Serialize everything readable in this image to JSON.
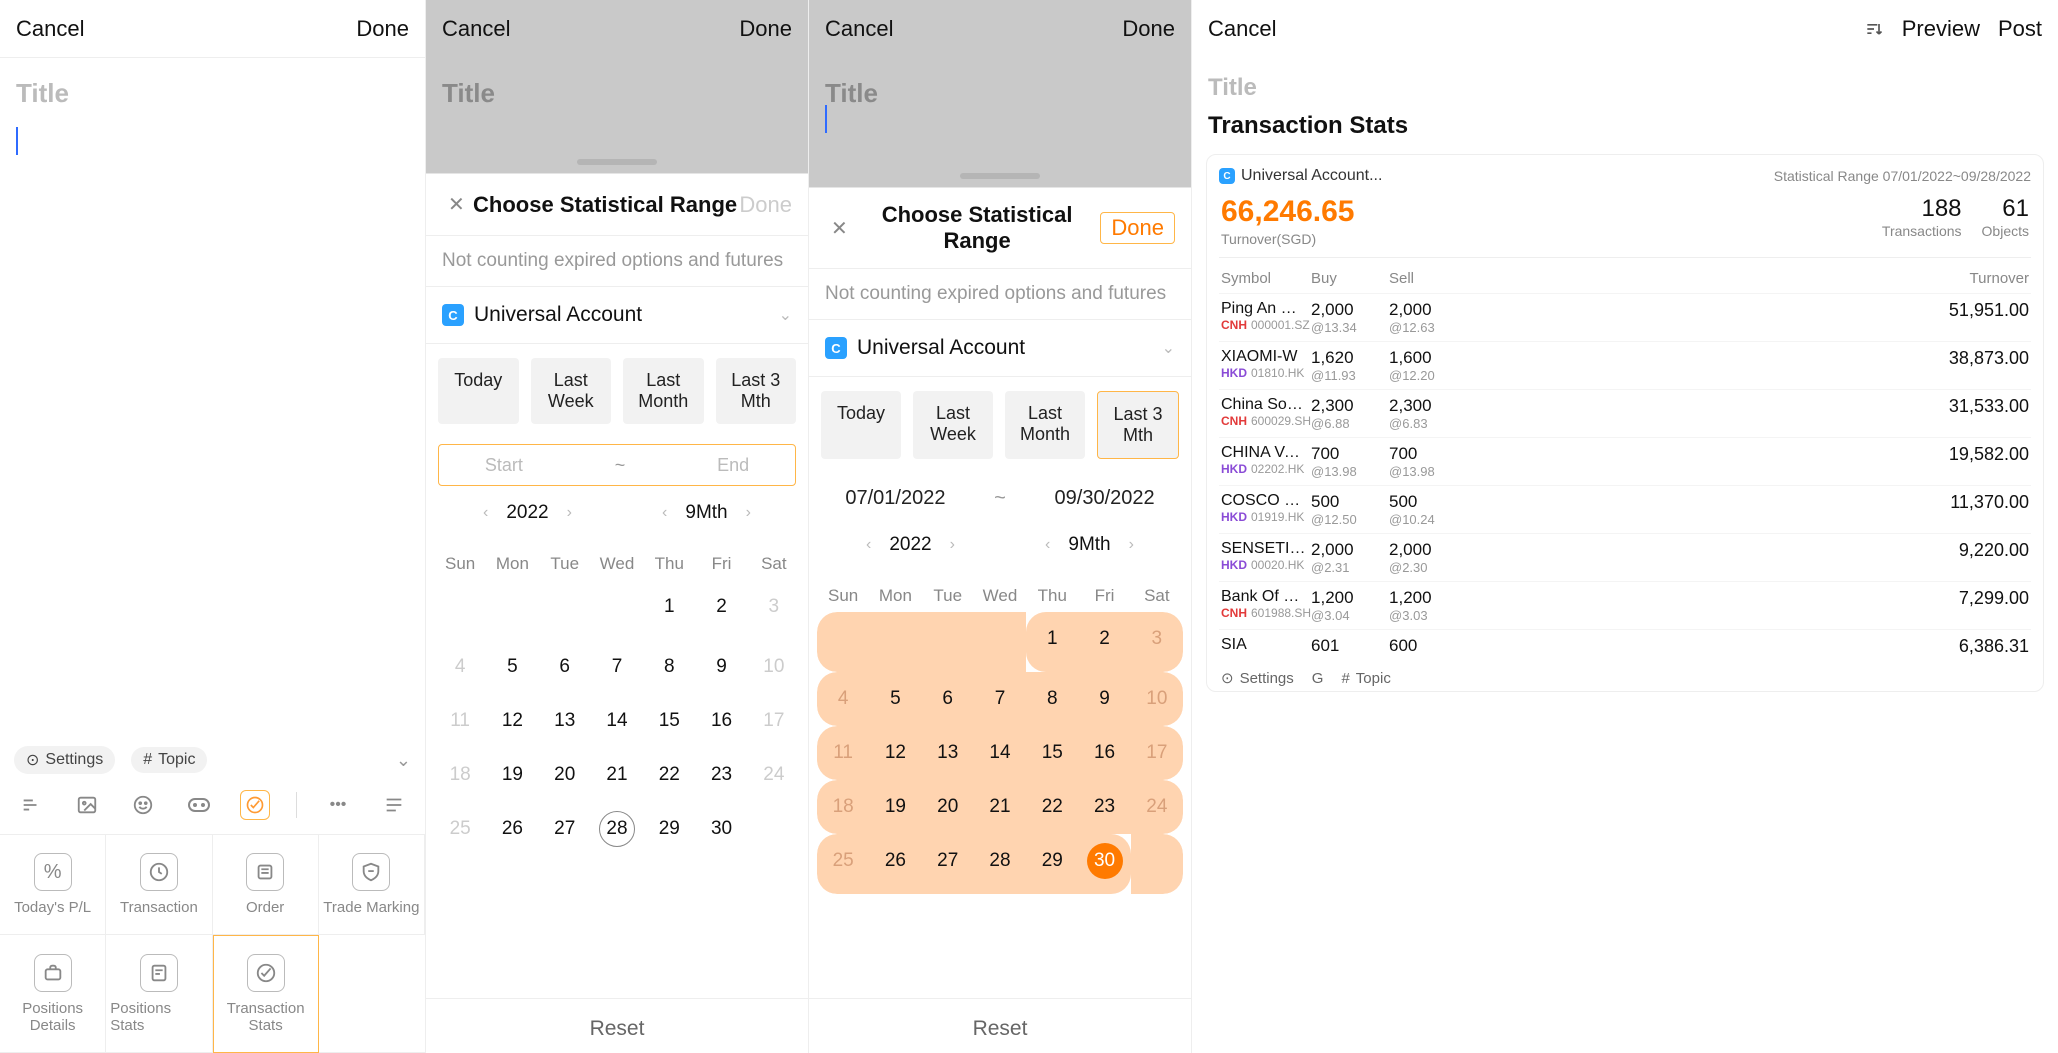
{
  "common": {
    "cancel": "Cancel",
    "done": "Done",
    "titlePlaceholder": "Title",
    "chooseRange": "Choose Statistical Range",
    "noteText": "Not counting expired options and futures",
    "account": "Universal Account",
    "reset": "Reset",
    "today": "Today",
    "lastWeek": "Last Week",
    "lastMonth": "Last Month",
    "last3": "Last 3 Mth",
    "start": "Start",
    "end": "End",
    "year": "2022",
    "month": "9Mth",
    "dow": [
      "Sun",
      "Mon",
      "Tue",
      "Wed",
      "Thu",
      "Fri",
      "Sat"
    ]
  },
  "panel1": {
    "settings": "Settings",
    "topic": "Topic",
    "cards": {
      "todaysPL": "Today's P/L",
      "transaction": "Transaction",
      "order": "Order",
      "tradeMarking": "Trade Marking",
      "positionsDetails": "Positions Details",
      "positionsStats": "Positions Stats",
      "transactionStats": "Transaction Stats"
    }
  },
  "panel3": {
    "startDate": "07/01/2022",
    "endDate": "09/30/2022"
  },
  "panel4": {
    "preview": "Preview",
    "post": "Post",
    "heading": "Transaction Stats",
    "acctLabel": "Universal Account...",
    "rangeLabel": "Statistical Range 07/01/2022~09/28/2022",
    "turnover": "66,246.65",
    "turnoverLabel": "Turnover(SGD)",
    "transactions": "188",
    "transactionsLabel": "Transactions",
    "objects": "61",
    "objectsLabel": "Objects",
    "cols": {
      "symbol": "Symbol",
      "buy": "Buy",
      "sell": "Sell",
      "turnover": "Turnover"
    },
    "rows": [
      {
        "sym": "Ping An Bank",
        "cur": "CNH",
        "code": "000001.SZ",
        "buyQ": "2,000",
        "buyP": "@13.34",
        "sellQ": "2,000",
        "sellP": "@12.63",
        "turn": "51,951.00"
      },
      {
        "sym": "XIAOMI-W",
        "cur": "HKD",
        "code": "01810.HK",
        "buyQ": "1,620",
        "buyP": "@11.93",
        "sellQ": "1,600",
        "sellP": "@12.20",
        "turn": "38,873.00"
      },
      {
        "sym": "China Southern Air...",
        "cur": "CNH",
        "code": "600029.SH",
        "buyQ": "2,300",
        "buyP": "@6.88",
        "sellQ": "2,300",
        "sellP": "@6.83",
        "turn": "31,533.00"
      },
      {
        "sym": "CHINA VANKE",
        "cur": "HKD",
        "code": "02202.HK",
        "buyQ": "700",
        "buyP": "@13.98",
        "sellQ": "700",
        "sellP": "@13.98",
        "turn": "19,582.00"
      },
      {
        "sym": "COSCO SHIP HOLD",
        "cur": "HKD",
        "code": "01919.HK",
        "buyQ": "500",
        "buyP": "@12.50",
        "sellQ": "500",
        "sellP": "@10.24",
        "turn": "11,370.00"
      },
      {
        "sym": "SENSETIME-W",
        "cur": "HKD",
        "code": "00020.HK",
        "buyQ": "2,000",
        "buyP": "@2.31",
        "sellQ": "2,000",
        "sellP": "@2.30",
        "turn": "9,220.00"
      },
      {
        "sym": "Bank Of China",
        "cur": "CNH",
        "code": "601988.SH",
        "buyQ": "1,200",
        "buyP": "@3.04",
        "sellQ": "1,200",
        "sellP": "@3.03",
        "turn": "7,299.00"
      },
      {
        "sym": "SIA",
        "cur": "",
        "code": "",
        "buyQ": "601",
        "buyP": "",
        "sellQ": "600",
        "sellP": "",
        "turn": "6,386.31"
      }
    ],
    "foot": {
      "settings": "Settings",
      "g": "G",
      "topic": "Topic"
    }
  },
  "cal2": {
    "weeks": [
      [
        "",
        "",
        "",
        "",
        "1",
        "2",
        "3d"
      ],
      [
        "4d",
        "5",
        "6",
        "7",
        "8",
        "9",
        "10d"
      ],
      [
        "11d",
        "12",
        "13",
        "14",
        "15",
        "16",
        "17d"
      ],
      [
        "18d",
        "19",
        "20",
        "21",
        "22",
        "23",
        "24d"
      ],
      [
        "25d",
        "26",
        "27",
        "28t",
        "29",
        "30",
        ""
      ]
    ]
  },
  "cal3": {
    "weeks": [
      [
        "",
        "",
        "",
        "",
        "1",
        "2",
        "3d"
      ],
      [
        "4d",
        "5",
        "6",
        "7",
        "8",
        "9",
        "10d"
      ],
      [
        "11d",
        "12",
        "13",
        "14",
        "15",
        "16",
        "17d"
      ],
      [
        "18d",
        "19",
        "20",
        "21",
        "22",
        "23",
        "24d"
      ],
      [
        "25d",
        "26",
        "27",
        "28",
        "29",
        "30e",
        ""
      ]
    ]
  }
}
